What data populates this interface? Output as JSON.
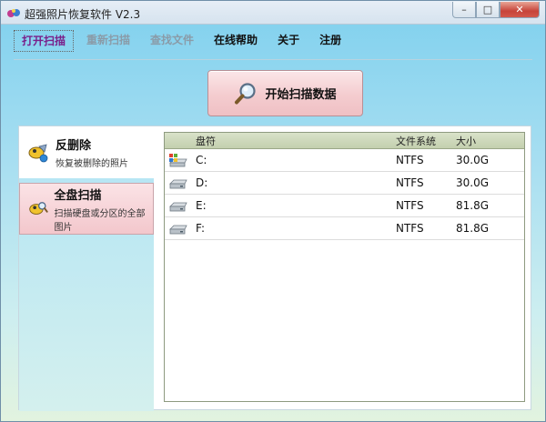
{
  "window": {
    "title": "超强照片恢复软件 V2.3",
    "controls": {
      "minimize": "–",
      "maximize": "□",
      "close": "✕"
    }
  },
  "menu": [
    {
      "label": "打开扫描",
      "state": "active"
    },
    {
      "label": "重新扫描",
      "state": "disabled"
    },
    {
      "label": "查找文件",
      "state": "disabled"
    },
    {
      "label": "在线帮助",
      "state": "normal"
    },
    {
      "label": "关于",
      "state": "normal"
    },
    {
      "label": "注册",
      "state": "normal"
    }
  ],
  "start_button": {
    "label": "开始扫描数据",
    "icon": "magnifier-icon"
  },
  "sidebar": {
    "items": [
      {
        "title": "反删除",
        "subtitle": "恢复被删除的照片",
        "icon": "undelete-icon"
      },
      {
        "title": "全盘扫描",
        "subtitle": "扫描硬盘或分区的全部图片",
        "icon": "disk-scan-icon"
      }
    ]
  },
  "drives": {
    "columns": {
      "name": "盘符",
      "fs": "文件系统",
      "size": "大小"
    },
    "rows": [
      {
        "name": "C:",
        "fs": "NTFS",
        "size": "30.0G",
        "system": true
      },
      {
        "name": "D:",
        "fs": "NTFS",
        "size": "30.0G",
        "system": false
      },
      {
        "name": "E:",
        "fs": "NTFS",
        "size": "81.8G",
        "system": false
      },
      {
        "name": "F:",
        "fs": "NTFS",
        "size": "81.8G",
        "system": false
      }
    ]
  },
  "colors": {
    "active_menu": "#7a1f8a",
    "disabled_menu": "#8a9ba8",
    "button_pink": "#f4cccf",
    "header_green": "#c3cfae"
  }
}
